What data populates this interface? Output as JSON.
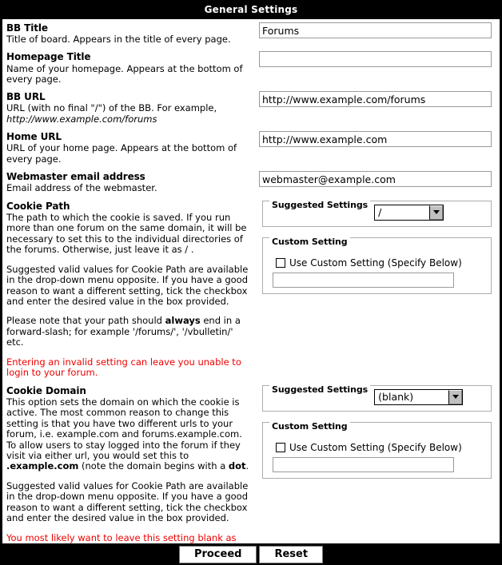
{
  "header": {
    "title": "General Settings"
  },
  "settings": [
    {
      "label": "BB Title",
      "description": "Title of board. Appears in the title of every page.",
      "value": "Forums"
    },
    {
      "label": "Homepage Title",
      "description": "Name of your homepage. Appears at the bottom of every page.",
      "value": ""
    },
    {
      "label": "BB URL",
      "description": "URL (with no final \"/\") of the BB. For example,",
      "description_italic": "http://www.example.com/forums",
      "value": "http://www.example.com/forums"
    },
    {
      "label": "Home URL",
      "description": "URL of your home page. Appears at the bottom of every page.",
      "value": "http://www.example.com"
    },
    {
      "label": "Webmaster email address",
      "description": "Email address of the webmaster.",
      "value": "webmaster@example.com"
    }
  ],
  "cookie_path": {
    "label": "Cookie Path",
    "description": "The path to which the cookie is saved. If you run more than one forum on the same domain, it will be necessary to set this to the individual directories of the forums. Otherwise, just leave it as / .",
    "paragraph2": "Suggested valid values for Cookie Path are available in the drop-down menu opposite. If you have a good reason to want a different setting, tick the checkbox and enter the desired value in the box provided.",
    "paragraph3_pre": "Please note that your path should ",
    "paragraph3_bold": "always",
    "paragraph3_post": " end in a forward-slash; for example '/forums/', '/vbulletin/' etc.",
    "warning": "Entering an invalid setting can leave you unable to login to your forum.",
    "suggested_legend": "Suggested Settings",
    "suggested_value": "/",
    "custom_legend": "Custom Setting",
    "custom_checkbox_label": "Use Custom Setting (Specify Below)",
    "custom_value": ""
  },
  "cookie_domain": {
    "label": "Cookie Domain",
    "description_pre": "This option sets the domain on which the cookie is active. The most common reason to change this setting is that you have two different urls to your forum, i.e. example.com and forums.example.com. To allow users to stay logged into the forum if they visit via either url, you would set this to ",
    "description_bold": ".example.com",
    "description_mid": " (note the domain begins with a ",
    "description_bold2": "dot",
    "description_post": ".",
    "paragraph2": "Suggested valid values for Cookie Path are available in the drop-down menu opposite. If you have a good reason to want a different setting, tick the checkbox and enter the desired value in the box provided.",
    "warning": "You most likely want to leave this setting blank as entering an invalid setting can leave you unable to login to your forum.",
    "suggested_legend": "Suggested Settings",
    "suggested_value": "(blank)",
    "custom_legend": "Custom Setting",
    "custom_checkbox_label": "Use Custom Setting (Specify Below)",
    "custom_value": ""
  },
  "footer": {
    "proceed_label": "Proceed",
    "reset_label": "Reset"
  },
  "colors": {
    "warning_text": "#ee0000",
    "header_bg": "#000000",
    "header_text": "#ffffff",
    "panel_bg": "#ffffff"
  }
}
